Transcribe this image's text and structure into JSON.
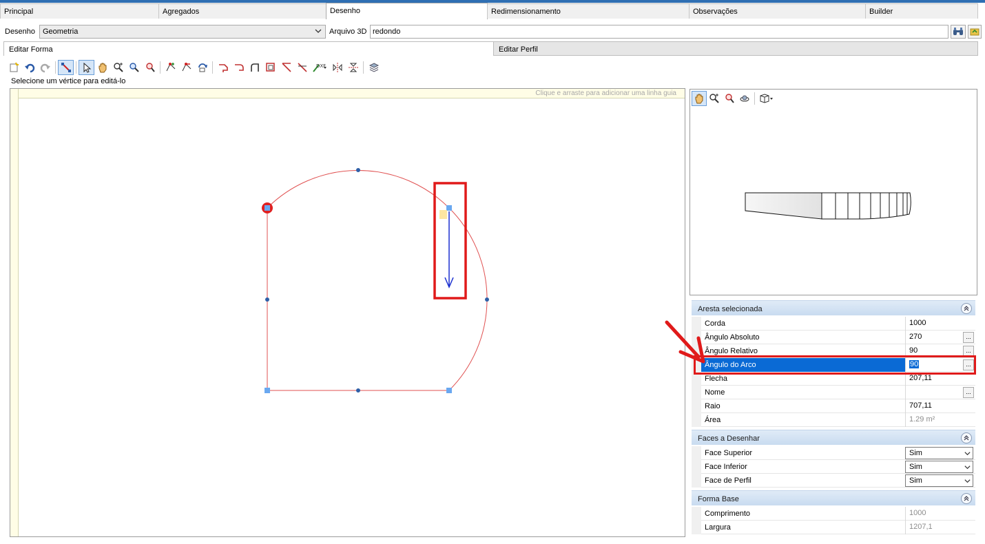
{
  "main_tabs": [
    "Principal",
    "Agregados",
    "Desenho",
    "Redimensionamento",
    "Observações",
    "Builder"
  ],
  "main_tab_active": "Desenho",
  "drawing": {
    "label": "Desenho",
    "value": "Geometria",
    "file3d_label": "Arquivo 3D",
    "file3d_value": "redondo"
  },
  "sub_tabs": [
    "Editar Forma",
    "Editar Perfil"
  ],
  "toolbar_icons": [
    "new-shape-icon",
    "undo-icon",
    "redo-icon",
    "edit-vertices-icon",
    "select-pointer-icon",
    "pan-hand-icon",
    "zoom-in-out-icon",
    "zoom-window-icon",
    "zoom-extents-icon",
    "add-vertex-icon",
    "remove-vertex-icon",
    "rotate-icon",
    "chamfer-icon",
    "fillet-icon",
    "corner-icon",
    "offset-icon",
    "cut-icon",
    "trim-icon",
    "dxf-import-icon",
    "mirror-horizontal-icon",
    "mirror-vertical-icon",
    "layers-3d-icon"
  ],
  "status_text": "Selecione um vértice para editá-lo",
  "canvas": {
    "ruler_hint": "Clique e arraste para adicionar uma linha guia"
  },
  "view3d_tools": [
    "pan-hand-icon",
    "zoom-in-out-icon",
    "zoom-window-icon",
    "orbit-icon",
    "view-cube-icon"
  ],
  "sections": {
    "aresta": {
      "title": "Aresta selecionada",
      "rows": [
        {
          "name": "Corda",
          "value": "1000"
        },
        {
          "name": "Ângulo Absoluto",
          "value": "270"
        },
        {
          "name": "Ângulo Relativo",
          "value": "90"
        },
        {
          "name": "Ângulo do Arco",
          "value": "90"
        },
        {
          "name": "Flecha",
          "value": "207,11"
        },
        {
          "name": "Nome",
          "value": ""
        },
        {
          "name": "Raio",
          "value": "707,11"
        },
        {
          "name": "Área",
          "value": "1.29 m²"
        }
      ]
    },
    "faces": {
      "title": "Faces a Desenhar",
      "rows": [
        {
          "name": "Face Superior",
          "value": "Sim"
        },
        {
          "name": "Face Inferior",
          "value": "Sim"
        },
        {
          "name": "Face de Perfil",
          "value": "Sim"
        }
      ]
    },
    "forma": {
      "title": "Forma Base",
      "rows": [
        {
          "name": "Comprimento",
          "value": "1000"
        },
        {
          "name": "Largura",
          "value": "1207,1"
        }
      ]
    }
  },
  "colors": {
    "selection": "#0a6ad5",
    "annotation": "#e01a1a",
    "edge": "#e05050",
    "vertex": "#2f5fa7",
    "arrow": "#1a2fd0"
  }
}
